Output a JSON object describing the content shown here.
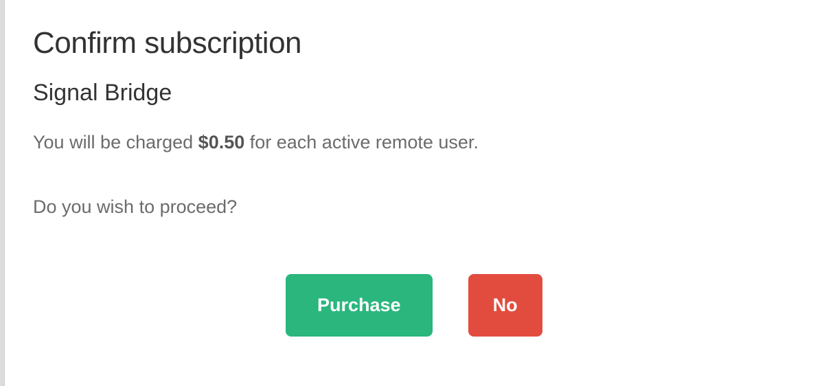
{
  "dialog": {
    "title": "Confirm subscription",
    "product_name": "Signal Bridge",
    "charge_text_before": "You will be charged ",
    "price": "$0.50",
    "charge_text_after": " for each active remote user.",
    "proceed_text": "Do you wish to proceed?",
    "purchase_label": "Purchase",
    "no_label": "No"
  }
}
